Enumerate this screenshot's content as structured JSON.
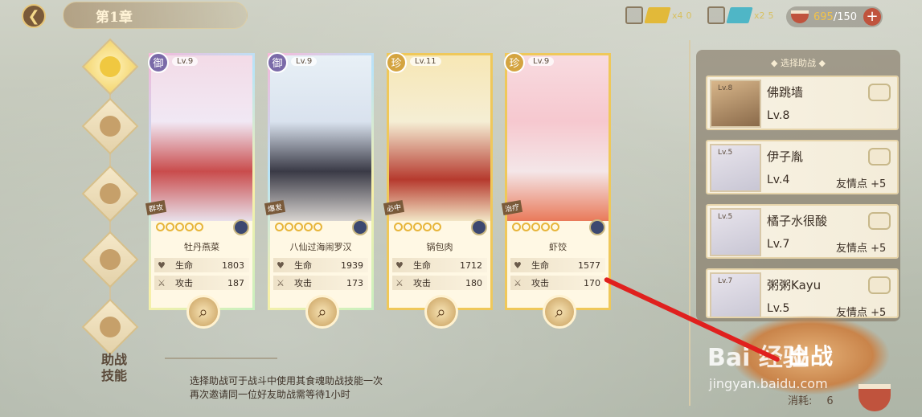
{
  "header": {
    "chapter": "第1章"
  },
  "resources": [
    {
      "count": "x4",
      "value": "0",
      "color": "#e2b939"
    },
    {
      "count": "x2",
      "value": "5",
      "color": "#4fb6c6"
    }
  ],
  "stamina": {
    "current": "695",
    "max": "/150"
  },
  "team": [
    {
      "rarity": "御",
      "level": "Lv.9",
      "role": "群攻",
      "name": "牡丹燕菜",
      "hp_label": "生命",
      "hp": "1803",
      "atk_label": "攻击",
      "atk": "187",
      "frame": "rainbow"
    },
    {
      "rarity": "御",
      "level": "Lv.9",
      "role": "爆发",
      "name": "八仙过海闹罗汉",
      "hp_label": "生命",
      "hp": "1939",
      "atk_label": "攻击",
      "atk": "173",
      "frame": "rainbow"
    },
    {
      "rarity": "珍",
      "level": "Lv.11",
      "role": "必中",
      "name": "锅包肉",
      "hp_label": "生命",
      "hp": "1712",
      "atk_label": "攻击",
      "atk": "180",
      "frame": "gold"
    },
    {
      "rarity": "珍",
      "level": "Lv.9",
      "role": "治疗",
      "name": "虾饺",
      "hp_label": "生命",
      "hp": "1577",
      "atk_label": "攻击",
      "atk": "170",
      "frame": "gold"
    }
  ],
  "support": {
    "title_line1": "助战",
    "title_line2": "技能",
    "desc_line1": "选择助战可于战斗中使用其食魂助战技能一次",
    "desc_line2": "再次邀请同一位好友助战需等待1小时"
  },
  "panel": {
    "title": "选择助战",
    "friends": [
      {
        "avatar_lv": "Lv.8",
        "name": "佛跳墙",
        "level": "Lv.8",
        "friendship": ""
      },
      {
        "avatar_lv": "Lv.5",
        "name": "伊子胤",
        "level": "Lv.4",
        "friendship": "友情点 +5"
      },
      {
        "avatar_lv": "Lv.5",
        "name": "橘子水很酸",
        "level": "Lv.7",
        "friendship": "友情点 +5"
      },
      {
        "avatar_lv": "Lv.7",
        "name": "粥粥Kayu",
        "level": "Lv.5",
        "friendship": "友情点 +5"
      }
    ]
  },
  "start": {
    "label": "出战",
    "cost_label": "消耗:",
    "cost": "6"
  },
  "watermark": {
    "line1": "Bai 经验",
    "line2": "jingyan.baidu.com"
  }
}
